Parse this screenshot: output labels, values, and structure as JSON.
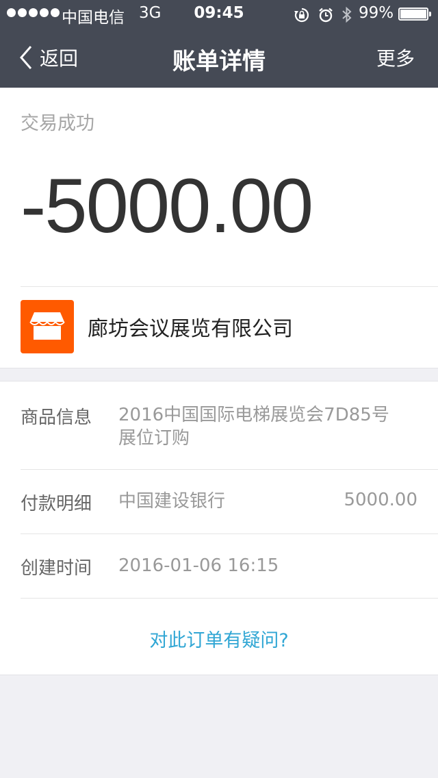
{
  "status_bar": {
    "carrier": "中国电信",
    "network": "3G",
    "time": "09:45",
    "battery_percent": "99%",
    "battery_level": 0.99,
    "icons": [
      "rotation-lock-icon",
      "alarm-icon",
      "bluetooth-icon"
    ]
  },
  "nav": {
    "back_label": "返回",
    "title": "账单详情",
    "more_label": "更多"
  },
  "summary": {
    "status": "交易成功",
    "amount": "-5000.00",
    "merchant_name": "廊坊会议展览有限公司",
    "merchant_icon": "shop-icon",
    "merchant_icon_color": "#ff5a00"
  },
  "details": {
    "product": {
      "label": "商品信息",
      "value_line1": "2016中国国际电梯展览会7D85号",
      "value_line2": "展位订购"
    },
    "payment": {
      "label": "付款明细",
      "value": "中国建设银行",
      "amount": "5000.00"
    },
    "created": {
      "label": "创建时间",
      "value": "2016-01-06 16:15"
    },
    "question_link": "对此订单有疑问?"
  },
  "colors": {
    "header_bg": "#454a55",
    "link": "#30a6d4"
  }
}
